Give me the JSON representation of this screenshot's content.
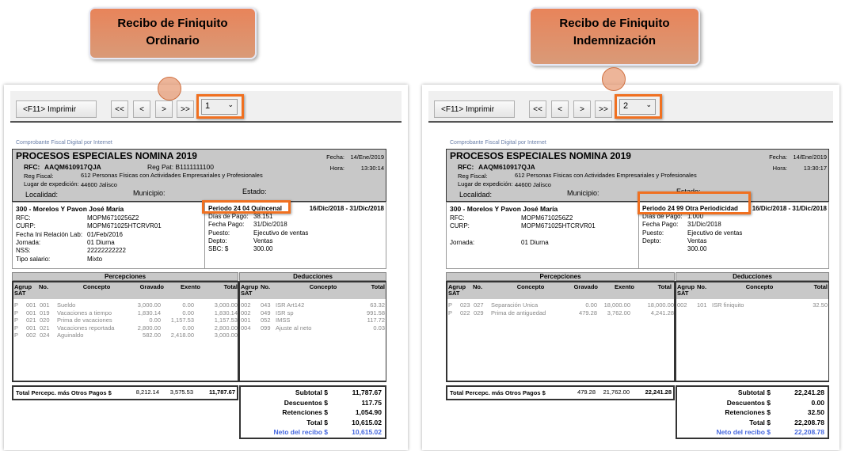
{
  "callouts": [
    {
      "line1": "Recibo de Finiquito",
      "line2": "Ordinario"
    },
    {
      "line1": "Recibo de Finiquito",
      "line2": "Indemnización"
    }
  ],
  "receipts": [
    {
      "toolbar": {
        "print": "<F11> Imprimir",
        "first": "<<",
        "prev": "<",
        "next": ">",
        "last": ">>",
        "page": "1",
        "chev": "⌄"
      },
      "cfdi": "Comprobante Fiscal Digital por Internet",
      "company": "PROCESOS ESPECIALES NOMINA 2019",
      "rfc_label": "RFC:",
      "rfc": "AAQM610917QJA",
      "regpat": "Reg Pat: B1111111100",
      "fecha_label": "Fecha:",
      "fecha": "14/Ene/2019",
      "hora_label": "Hora:",
      "hora": "13:30:14",
      "regfiscal_label": "Reg Fiscal:",
      "regfiscal": "612 Personas Físicas con Actividades Empresariales y Profesionales",
      "lugar_label": "Lugar de expedición:",
      "lugar": "44600 Jalisco",
      "localidad": "Localidad:",
      "municipio": "Municipio:",
      "estado": "Estado:",
      "employee": "300 - Morelos Y Pavon José María",
      "left_fields": [
        [
          "RFC:",
          "MOPM6710256Z2"
        ],
        [
          "CURP:",
          "MOPM671025HTCRVR01"
        ],
        [
          "Fecha Ini Relación Lab:",
          "01/Feb/2016"
        ],
        [
          "Jornada:",
          "01 Diurna"
        ],
        [
          "NSS:",
          "22222222222"
        ],
        [
          "Tipo salario:",
          "Mixto"
        ]
      ],
      "periodo": "Periodo 24 04 Quincenal",
      "rango": "16/Dic/2018 - 31/Dic/2018",
      "right_fields": [
        [
          "Días de Pago:",
          "38.151"
        ],
        [
          "Fecha Pago:",
          "31/Dic/2018"
        ],
        [
          "Puesto:",
          "Ejecutivo de ventas"
        ],
        [
          "Depto:",
          "Ventas"
        ],
        [
          "SBC: $",
          "300.00"
        ]
      ],
      "perc_title": "Percepciones",
      "ded_title": "Deducciones",
      "perc_cols": [
        "Agrup SAT",
        "No.",
        "Concepto",
        "Gravado",
        "Exento",
        "Total"
      ],
      "ded_cols": [
        "Agrup SAT",
        "No.",
        "Concepto",
        "Total"
      ],
      "percepciones": [
        [
          "P",
          "001",
          "001",
          "Sueldo",
          "3,000.00",
          "0.00",
          "3,000.00"
        ],
        [
          "P",
          "001",
          "019",
          "Vacaciones a tiempo",
          "1,830.14",
          "0.00",
          "1,830.14"
        ],
        [
          "P",
          "021",
          "020",
          "Prima de vacaciones",
          "0.00",
          "1,157.53",
          "1,157.53"
        ],
        [
          "P",
          "001",
          "021",
          "Vacaciones reportada",
          "2,800.00",
          "0.00",
          "2,800.00"
        ],
        [
          "P",
          "002",
          "024",
          "Aguinaldo",
          "582.00",
          "2,418.00",
          "3,000.00"
        ]
      ],
      "deducciones": [
        [
          "002",
          "043",
          "ISR Art142",
          "63.32"
        ],
        [
          "002",
          "049",
          "ISR sp",
          "991.58"
        ],
        [
          "001",
          "052",
          "IMSS",
          "117.72"
        ],
        [
          "004",
          "099",
          "Ajuste al neto",
          "0.03"
        ]
      ],
      "total_label": "Total Percepc. más Otros Pagos  $",
      "total_gravado": "8,212.14",
      "total_exento": "3,575.53",
      "total_total": "11,787.67",
      "summary": [
        [
          "Subtotal $",
          "11,787.67"
        ],
        [
          "Descuentos $",
          "117.75"
        ],
        [
          "Retenciones $",
          "1,054.90"
        ],
        [
          "Total $",
          "10,615.02"
        ],
        [
          "Neto del recibo $",
          "10,615.02"
        ]
      ]
    },
    {
      "toolbar": {
        "print": "<F11> Imprimir",
        "first": "<<",
        "prev": "<",
        "next": ">",
        "last": ">>",
        "page": "2",
        "chev": "⌄"
      },
      "cfdi": "Comprobante Fiscal Digital por Internet",
      "company": "PROCESOS ESPECIALES NOMINA 2019",
      "rfc_label": "RFC:",
      "rfc": "AAQM610917QJA",
      "regpat": "",
      "fecha_label": "Fecha:",
      "fecha": "14/Ene/2019",
      "hora_label": "Hora:",
      "hora": "13:30:17",
      "regfiscal_label": "Reg Fiscal:",
      "regfiscal": "612 Personas Físicas con Actividades Empresariales y Profesionales",
      "lugar_label": "Lugar de expedición:",
      "lugar": "44600 Jalisco",
      "localidad": "Localidad:",
      "municipio": "Municipio:",
      "estado": "Estado:",
      "employee": "300 - Morelos Y Pavon José María",
      "left_fields": [
        [
          "RFC:",
          "MOPM6710256Z2"
        ],
        [
          "CURP:",
          "MOPM671025HTCRVR01"
        ],
        [
          "",
          ""
        ],
        [
          "Jornada:",
          "01 Diurna"
        ],
        [
          "",
          ""
        ],
        [
          "",
          ""
        ]
      ],
      "periodo": "Periodo 24 99 Otra Periodicidad",
      "rango": "16/Dic/2018 - 31/Dic/2018",
      "right_fields": [
        [
          "Días de Pago:",
          "1.000"
        ],
        [
          "Fecha Pago:",
          "31/Dic/2018"
        ],
        [
          "Puesto:",
          "Ejecutivo de ventas"
        ],
        [
          "Depto:",
          "Ventas"
        ],
        [
          "",
          "300.00"
        ]
      ],
      "perc_title": "Percepciones",
      "ded_title": "Deducciones",
      "perc_cols": [
        "Agrup SAT",
        "No.",
        "Concepto",
        "Gravado",
        "Exento",
        "Total"
      ],
      "ded_cols": [
        "Agrup SAT",
        "No.",
        "Concepto",
        "Total"
      ],
      "percepciones": [
        [
          "P",
          "023",
          "027",
          "Separación Unica",
          "0.00",
          "18,000.00",
          "18,000.00"
        ],
        [
          "P",
          "022",
          "029",
          "Prima de antiguedad",
          "479.28",
          "3,762.00",
          "4,241.28"
        ]
      ],
      "deducciones": [
        [
          "002",
          "101",
          "ISR finiquito",
          "32.50"
        ]
      ],
      "total_label": "Total Percepc. más Otros Pagos  $",
      "total_gravado": "479.28",
      "total_exento": "21,762.00",
      "total_total": "22,241.28",
      "summary": [
        [
          "Subtotal $",
          "22,241.28"
        ],
        [
          "Descuentos $",
          "0.00"
        ],
        [
          "Retenciones $",
          "32.50"
        ],
        [
          "Total $",
          "22,208.78"
        ],
        [
          "Neto del recibo $",
          "22,208.78"
        ]
      ]
    }
  ],
  "colors": {
    "accent": "#f07020",
    "link": "#4466dd"
  }
}
